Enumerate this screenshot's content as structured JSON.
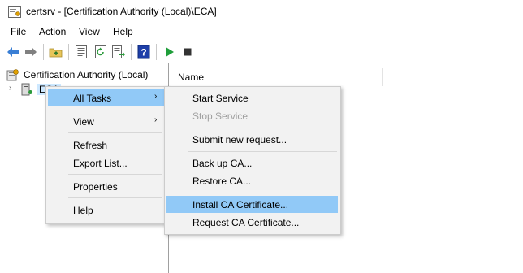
{
  "window": {
    "title": "certsrv - [Certification Authority (Local)\\ECA]"
  },
  "menubar": {
    "items": [
      "File",
      "Action",
      "View",
      "Help"
    ]
  },
  "tree": {
    "root_label": "Certification Authority (Local)",
    "child_label": "ECA"
  },
  "list": {
    "column_header": "Name"
  },
  "context_menu": {
    "items": [
      {
        "label": "All Tasks",
        "has_submenu": true,
        "highlighted": true
      },
      {
        "label": "View",
        "has_submenu": true
      },
      {
        "label": "Refresh"
      },
      {
        "label": "Export List..."
      },
      {
        "label": "Properties"
      },
      {
        "label": "Help"
      }
    ],
    "submenu_arrow": "›"
  },
  "submenu": {
    "items": [
      {
        "label": "Start Service",
        "enabled": true
      },
      {
        "label": "Stop Service",
        "enabled": false
      },
      {
        "label": "Submit new request...",
        "enabled": true
      },
      {
        "label": "Back up CA...",
        "enabled": true
      },
      {
        "label": "Restore CA...",
        "enabled": true
      },
      {
        "label": "Install CA Certificate...",
        "enabled": true,
        "highlighted": true
      },
      {
        "label": "Request CA Certificate...",
        "enabled": true
      }
    ]
  },
  "icons": {
    "back": "back-arrow-icon",
    "forward": "forward-arrow-icon",
    "up": "up-folder-icon",
    "properties": "properties-icon",
    "refresh": "refresh-icon",
    "export": "export-list-icon",
    "help": "help-icon",
    "start": "play-icon",
    "stop": "stop-icon"
  },
  "colors": {
    "highlight": "#91c9f7",
    "menu_bg": "#f2f2f2",
    "back_arrow": "#3a7fd5",
    "play": "#1f9e3a"
  }
}
